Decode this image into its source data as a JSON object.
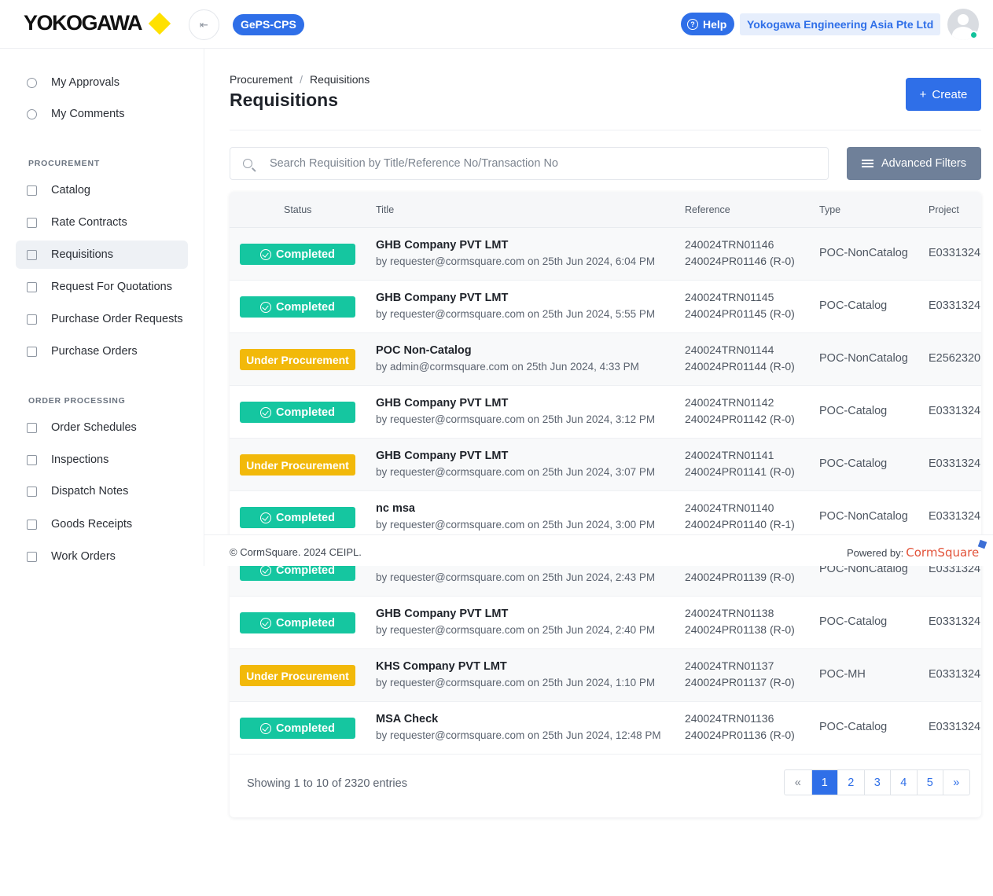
{
  "header": {
    "logo": "YOKOGAWA",
    "app_name": "GePS-CPS",
    "help_label": "Help",
    "company": "Yokogawa Engineering Asia Pte Ltd"
  },
  "sidebar": {
    "top_items": [
      {
        "label": "My Approvals",
        "icon": "check-circle-icon"
      },
      {
        "label": "My Comments",
        "icon": "check-circle-icon"
      }
    ],
    "procurement_heading": "PROCUREMENT",
    "procurement_items": [
      {
        "label": "Catalog",
        "icon": "catalog-icon"
      },
      {
        "label": "Rate Contracts",
        "icon": "briefcase-icon"
      },
      {
        "label": "Requisitions",
        "icon": "document-icon",
        "active": true
      },
      {
        "label": "Request For Quotations",
        "icon": "document-icon"
      },
      {
        "label": "Purchase Order Requests",
        "icon": "document-icon"
      },
      {
        "label": "Purchase Orders",
        "icon": "bar-chart-icon"
      }
    ],
    "order_heading": "ORDER PROCESSING",
    "order_items": [
      {
        "label": "Order Schedules",
        "icon": "calendar-icon"
      },
      {
        "label": "Inspections",
        "icon": "checklist-icon"
      },
      {
        "label": "Dispatch Notes",
        "icon": "document-icon"
      },
      {
        "label": "Goods Receipts",
        "icon": "receipt-icon"
      },
      {
        "label": "Work Orders",
        "icon": "document-icon"
      }
    ]
  },
  "page": {
    "breadcrumb_parent": "Procurement",
    "breadcrumb_sep": "/",
    "breadcrumb_current": "Requisitions",
    "title": "Requisitions",
    "create_label": "Create",
    "search_placeholder": "Search Requisition by Title/Reference No/Transaction No",
    "advanced_filters_label": "Advanced Filters"
  },
  "table": {
    "columns": [
      "Status",
      "Title",
      "Reference",
      "Type",
      "Project"
    ],
    "rows": [
      {
        "status": "Completed",
        "title": "GHB Company PVT LMT",
        "by": "by requester@cormsquare.com on 25th Jun 2024, 6:04 PM",
        "ref1": "240024TRN01146",
        "ref2": "240024PR01146 (R-0)",
        "type": "POC-NonCatalog",
        "project": "E0331324"
      },
      {
        "status": "Completed",
        "title": "GHB Company PVT LMT",
        "by": "by requester@cormsquare.com on 25th Jun 2024, 5:55 PM",
        "ref1": "240024TRN01145",
        "ref2": "240024PR01145 (R-0)",
        "type": "POC-Catalog",
        "project": "E0331324"
      },
      {
        "status": "Under Procurement",
        "title": "POC Non-Catalog",
        "by": "by admin@cormsquare.com on 25th Jun 2024, 4:33 PM",
        "ref1": "240024TRN01144",
        "ref2": "240024PR01144 (R-0)",
        "type": "POC-NonCatalog",
        "project": "E2562320"
      },
      {
        "status": "Completed",
        "title": "GHB Company PVT LMT",
        "by": "by requester@cormsquare.com on 25th Jun 2024, 3:12 PM",
        "ref1": "240024TRN01142",
        "ref2": "240024PR01142 (R-0)",
        "type": "POC-Catalog",
        "project": "E0331324"
      },
      {
        "status": "Under Procurement",
        "title": "GHB Company PVT LMT",
        "by": "by requester@cormsquare.com on 25th Jun 2024, 3:07 PM",
        "ref1": "240024TRN01141",
        "ref2": "240024PR01141 (R-0)",
        "type": "POC-Catalog",
        "project": "E0331324"
      },
      {
        "status": "Completed",
        "title": "nc msa",
        "by": "by requester@cormsquare.com on 25th Jun 2024, 3:00 PM",
        "ref1": "240024TRN01140",
        "ref2": "240024PR01140 (R-1)",
        "type": "POC-NonCatalog",
        "project": "E0331324"
      },
      {
        "status": "Completed",
        "title": "",
        "by": "by requester@cormsquare.com on 25th Jun 2024, 2:43 PM",
        "ref1": "",
        "ref2": "240024PR01139 (R-0)",
        "type": "POC-NonCatalog",
        "project": "E0331324"
      },
      {
        "status": "Completed",
        "title": "GHB Company PVT LMT",
        "by": "by requester@cormsquare.com on 25th Jun 2024, 2:40 PM",
        "ref1": "240024TRN01138",
        "ref2": "240024PR01138 (R-0)",
        "type": "POC-Catalog",
        "project": "E0331324"
      },
      {
        "status": "Under Procurement",
        "title": "KHS Company PVT LMT",
        "by": "by requester@cormsquare.com on 25th Jun 2024, 1:10 PM",
        "ref1": "240024TRN01137",
        "ref2": "240024PR01137 (R-0)",
        "type": "POC-MH",
        "project": "E0331324"
      },
      {
        "status": "Completed",
        "title": "MSA Check",
        "by": "by requester@cormsquare.com on 25th Jun 2024, 12:48 PM",
        "ref1": "240024TRN01136",
        "ref2": "240024PR01136 (R-0)",
        "type": "POC-Catalog",
        "project": "E0331324"
      }
    ]
  },
  "footer": {
    "copyright": "© CormSquare. 2024 CEIPL.",
    "powered_by": "Powered by:",
    "brand": "CormSquare"
  },
  "pagination": {
    "showing": "Showing 1 to 10 of 2320 entries",
    "prev": "«",
    "pages": [
      "1",
      "2",
      "3",
      "4",
      "5"
    ],
    "next": "»",
    "current": "1"
  },
  "colors": {
    "accent": "#2f6fe8",
    "completed": "#15c6a0",
    "under_procurement": "#f2b90a",
    "filter_button": "#6f8099"
  }
}
